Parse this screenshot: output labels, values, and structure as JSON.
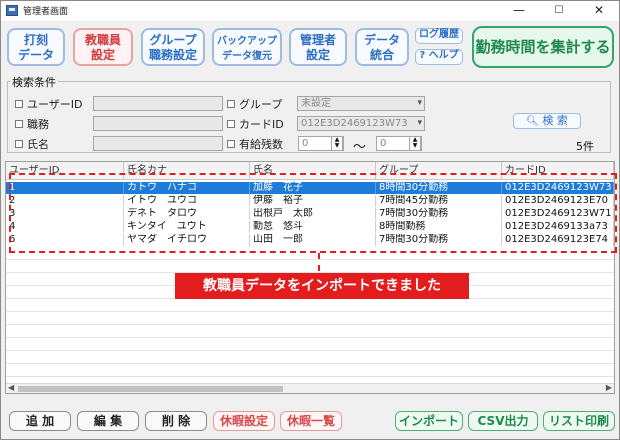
{
  "window": {
    "title": "管理者画面",
    "controls": [
      "—",
      "☐",
      "✕"
    ]
  },
  "toolbar": {
    "buttons": [
      {
        "line1": "打刻",
        "line2": "データ"
      },
      {
        "line1": "教職員",
        "line2": "設定"
      },
      {
        "line1": "グループ",
        "line2": "職務設定"
      },
      {
        "line1": "バックアップ",
        "line2": "データ復元"
      },
      {
        "line1": "管理者",
        "line2": "設定"
      },
      {
        "line1": "データ",
        "line2": "統合"
      }
    ],
    "log_label": "ログ履歴",
    "help_label": "? ヘルプ",
    "tally_label": "勤務時間を集計する"
  },
  "search": {
    "legend": "検索条件",
    "user_id_label": "ユーザーID",
    "job_label": "職務",
    "name_label": "氏名",
    "group_label": "グループ",
    "group_value": "未設定",
    "card_label": "カードID",
    "card_value": "012E3D2469123W73",
    "paid_leave_label": "有給残数",
    "paid_from": "0",
    "paid_to": "0",
    "range_sep": "〜",
    "search_button": "検 索",
    "result_count": "5件"
  },
  "table": {
    "columns": [
      "ユーザーID",
      "氏名カナ",
      "氏名",
      "グループ",
      "カードID"
    ],
    "rows": [
      [
        "1",
        "カトウ　ハナコ",
        "加藤　花子",
        "8時間30分勤務",
        "012E3D2469123W73"
      ],
      [
        "2",
        "イトウ　ユウコ",
        "伊藤　裕子",
        "7時間45分勤務",
        "012E3D2469123E70"
      ],
      [
        "3",
        "デネト　タロウ",
        "出根戸　太郎",
        "7時間30分勤務",
        "012E3D2469123W71"
      ],
      [
        "4",
        "キンタイ　ユウト",
        "勤怠　悠斗",
        "8時間勤務",
        "012E3D2469133a73"
      ],
      [
        "6",
        "ヤマダ　イチロウ",
        "山田　一郎",
        "7時間30分勤務",
        "012E3D2469123E74"
      ]
    ]
  },
  "annotation": {
    "text": "教職員データをインポートできました"
  },
  "bottom": {
    "add": "追 加",
    "edit": "編 集",
    "delete": "削 除",
    "leave_setting": "休暇設定",
    "leave_list": "休暇一覧",
    "import": "インポート",
    "csv": "CSV出力",
    "print": "リスト印刷"
  }
}
